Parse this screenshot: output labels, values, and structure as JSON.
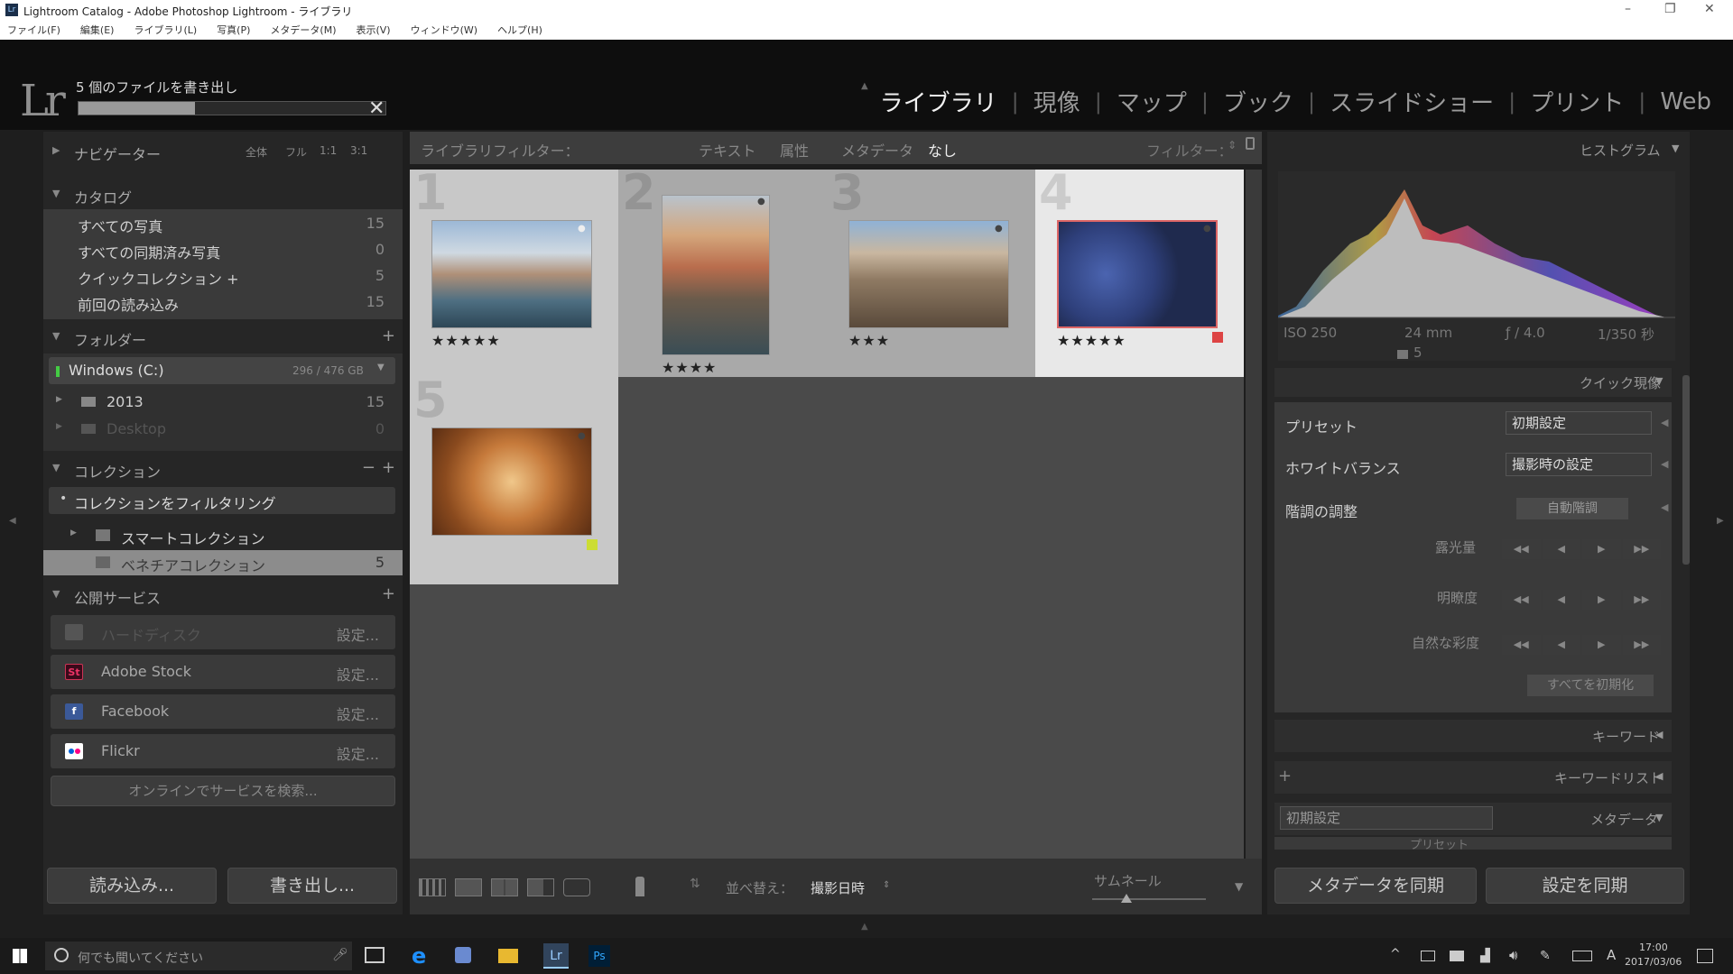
{
  "window": {
    "title": "Lightroom Catalog - Adobe Photoshop Lightroom - ライブラリ",
    "min": "–",
    "max": "❐",
    "close": "✕"
  },
  "menu": [
    "ファイル(F)",
    "編集(E)",
    "ライブラリ(L)",
    "写真(P)",
    "メタデータ(M)",
    "表示(V)",
    "ウィンドウ(W)",
    "ヘルプ(H)"
  ],
  "top": {
    "logo": "Lr",
    "export_text": "5 個のファイルを書き出し",
    "export_progress": 0.38,
    "modules": [
      "ライブラリ",
      "現像",
      "マップ",
      "ブック",
      "スライドショー",
      "プリント",
      "Web"
    ],
    "active_module": "ライブラリ"
  },
  "left": {
    "navigator": {
      "title": "ナビゲーター",
      "zoom": [
        "全体",
        "フル",
        "1:1",
        "3:1"
      ]
    },
    "catalog": {
      "title": "カタログ",
      "items": [
        {
          "label": "すべての写真",
          "count": "15"
        },
        {
          "label": "すべての同期済み写真",
          "count": "0"
        },
        {
          "label": "クイックコレクション +",
          "count": "5"
        },
        {
          "label": "前回の読み込み",
          "count": "15"
        }
      ]
    },
    "folders": {
      "title": "フォルダー",
      "volume": "Windows (C:)",
      "volume_size": "296 / 476 GB",
      "items": [
        {
          "label": "2013",
          "count": "15"
        },
        {
          "label": "Desktop",
          "count": "0"
        }
      ]
    },
    "collections": {
      "title": "コレクション",
      "filter": "コレクションをフィルタリング",
      "items": [
        {
          "label": "スマートコレクション",
          "count": ""
        },
        {
          "label": "ベネチアコレクション",
          "count": "5"
        }
      ]
    },
    "publish": {
      "title": "公開サービス",
      "services": [
        {
          "label": "ハードディスク",
          "action": "設定...",
          "icon": "hdd-icon"
        },
        {
          "label": "Adobe Stock",
          "action": "設定...",
          "icon": "St"
        },
        {
          "label": "Facebook",
          "action": "設定...",
          "icon": "f"
        },
        {
          "label": "Flickr",
          "action": "設定...",
          "icon": "flickr-icon"
        }
      ],
      "find": "オンラインでサービスを検索..."
    },
    "import_btn": "読み込み...",
    "export_btn": "書き出し..."
  },
  "filterbar": {
    "title": "ライブラリフィルター：",
    "tabs": [
      "テキスト",
      "属性",
      "メタデータ",
      "なし"
    ],
    "preset": "フィルター："
  },
  "grid": [
    {
      "num": "1",
      "stars": "★★★★★"
    },
    {
      "num": "2",
      "stars": "★★★★"
    },
    {
      "num": "3",
      "stars": "★★★"
    },
    {
      "num": "4",
      "stars": "★★★★★"
    },
    {
      "num": "5",
      "stars": ""
    }
  ],
  "toolbar": {
    "sort_label": "並べ替え：",
    "sort_value": "撮影日時",
    "thumb_label": "サムネール",
    "thumb_level": 0.3
  },
  "right": {
    "histogram": {
      "title": "ヒストグラム",
      "iso": "ISO 250",
      "focal": "24 mm",
      "aperture": "ƒ / 4.0",
      "shutter": "1/350 秒",
      "count": "5"
    },
    "quick_develop": {
      "title": "クイック現像",
      "preset_label": "プリセット",
      "preset_value": "初期設定",
      "wb_label": "ホワイトバランス",
      "wb_value": "撮影時の設定",
      "tone_label": "階調の調整",
      "auto_tone": "自動階調",
      "exposure": "露光量",
      "clarity": "明瞭度",
      "vibrance": "自然な彩度",
      "reset_all": "すべてを初期化"
    },
    "keywording": "キーワード",
    "keyword_list": "キーワードリスト",
    "metadata_preset": "初期設定",
    "metadata": "メタデータ",
    "metadata_sub": "プリセット",
    "sync_meta": "メタデータを同期",
    "sync_settings": "設定を同期"
  },
  "taskbar": {
    "search": "何でも聞いてください",
    "time": "17:00",
    "date": "2017/03/06",
    "ime": "A"
  }
}
